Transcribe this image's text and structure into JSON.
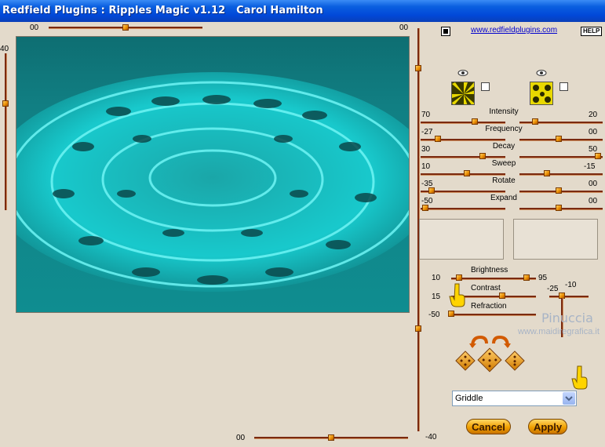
{
  "window": {
    "title": "Redfield Plugins : Ripples Magic v1.12   Carol Hamilton"
  },
  "top_slider": {
    "left_value": "00",
    "right_value": "00"
  },
  "left_slider": {
    "value": "40"
  },
  "bottom_slider": {
    "left_value": "00",
    "right_value": "-40"
  },
  "header": {
    "link": "www.redfieldplugins.com",
    "help": "HELP"
  },
  "params": [
    {
      "name": "Intensity",
      "left": "70",
      "right": "20"
    },
    {
      "name": "Frequency",
      "left": "-27",
      "right": "00"
    },
    {
      "name": "Decay",
      "left": "30",
      "right": "50"
    },
    {
      "name": "Sweep",
      "left": "10",
      "right": "-15"
    },
    {
      "name": "Rotate",
      "left": "-35",
      "right": "00"
    },
    {
      "name": "Expand",
      "left": "-50",
      "right": "00"
    }
  ],
  "lighting": {
    "brightness_label": "Brightness",
    "brightness_value": "10",
    "brightness_max": "95",
    "contrast_label": "Contrast",
    "contrast_value": "15",
    "refraction_label": "Refraction",
    "refraction_value": "-50",
    "small_left": "-25",
    "small_right": "-10"
  },
  "watermark": {
    "name": "Pinuccia",
    "site": "www.maidiregrafica.it"
  },
  "preset": {
    "selected": "Griddle"
  },
  "buttons": {
    "cancel": "Cancel",
    "apply": "Apply"
  },
  "icons": {
    "eye": "eye-icon",
    "pattern_a": "radial-pattern-icon",
    "pattern_b": "checker-pattern-icon",
    "pointer": "pointing-hand-icon",
    "undo": "curved-arrow-left-icon",
    "redo": "curved-arrow-right-icon",
    "dice": "dice-icon"
  },
  "colors": {
    "accent": "#e88a00",
    "water": "#1ed9dc",
    "title_bar": "#0a5fe0"
  }
}
